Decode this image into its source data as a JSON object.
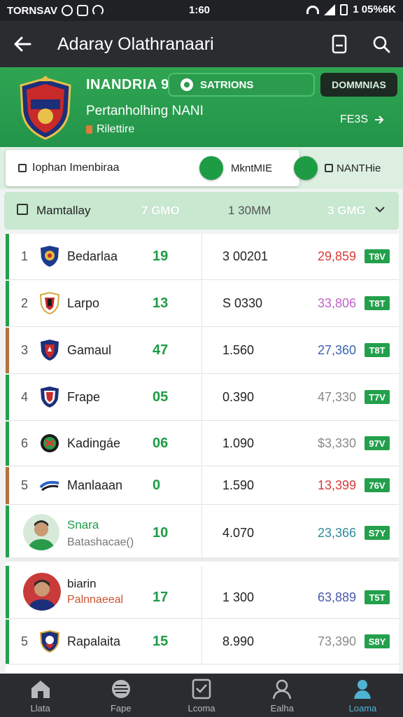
{
  "status_bar": {
    "carrier": "TORNSAV",
    "time": "1:60",
    "battery": "1 05%6K"
  },
  "app_bar": {
    "title": "Adaray Olathranaari"
  },
  "team": {
    "name": "INANDRIA 9",
    "subtitle": "Pertanholhing NANI",
    "subtitle2": "Rilettire",
    "stat_chip": "SATRIONS",
    "dark_chip": "DOMMNIAS",
    "follow_label": "FE3S"
  },
  "filters": {
    "main_label": "Iophan Imenbiraa",
    "toggle1_label": "MkntMIE",
    "toggle2_label": "NANTHie"
  },
  "summary": {
    "label": "Mamtallay",
    "value_a": "7 GMO",
    "value_b": "1 30MM",
    "value_c": "3 GMG"
  },
  "rows": [
    {
      "rank": "1",
      "name": "Bedarlaa",
      "played": "19",
      "stat": "3 00201",
      "score": "29,859",
      "score_color": "#d93a3a",
      "tag": "T8V",
      "accent": "#23a04c"
    },
    {
      "rank": "2",
      "name": "Larpo",
      "played": "13",
      "stat": "S 0330",
      "score": "33,806",
      "score_color": "#c065c8",
      "tag": "T8T",
      "accent": "#23a04c"
    },
    {
      "rank": "3",
      "name": "Gamaul",
      "played": "47",
      "stat": "1.560",
      "score": "27,360",
      "score_color": "#3a64b0",
      "tag": "T8T",
      "accent": "#b2723e"
    },
    {
      "rank": "4",
      "name": "Frape",
      "played": "05",
      "stat": "0.390",
      "score": "47,330",
      "score_color": "#8a8a8a",
      "tag": "T7V",
      "accent": "#23a04c"
    },
    {
      "rank": "6",
      "name": "Kadingáe",
      "played": "06",
      "stat": "1.090",
      "score": "$3,330",
      "score_color": "#8a8a8a",
      "tag": "97V",
      "accent": "#23a04c"
    },
    {
      "rank": "5",
      "name": "Manlaaan",
      "played": "0",
      "stat": "1.590",
      "score": "13,399",
      "score_color": "#d93a3a",
      "tag": "76V",
      "accent": "#b2723e"
    },
    {
      "rank": "",
      "name": "Snara",
      "name2": "Batashacae()",
      "played": "10",
      "stat": "4.070",
      "score": "23,366",
      "score_color": "#2f8a9a",
      "tag": "S7Y",
      "accent": "#23a04c"
    },
    {
      "rank": "",
      "name": "biarin",
      "name2": "Palnnaeeal",
      "played": "17",
      "stat": "1 300",
      "score": "63,889",
      "score_color": "#4a5ab0",
      "tag": "T5T",
      "accent": "#23a04c"
    },
    {
      "rank": "5",
      "name": "Rapalaita",
      "played": "15",
      "stat": "8.990",
      "score": "73,390",
      "score_color": "#8a8a8a",
      "tag": "S8Y",
      "accent": "#23a04c"
    }
  ],
  "nav": [
    {
      "label": "Llata",
      "icon": "home-icon"
    },
    {
      "label": "Fape",
      "icon": "ball-icon"
    },
    {
      "label": "Lcoma",
      "icon": "check-icon"
    },
    {
      "label": "Ealha",
      "icon": "person-icon"
    },
    {
      "label": "Loama",
      "icon": "profile-icon",
      "active": true
    }
  ]
}
